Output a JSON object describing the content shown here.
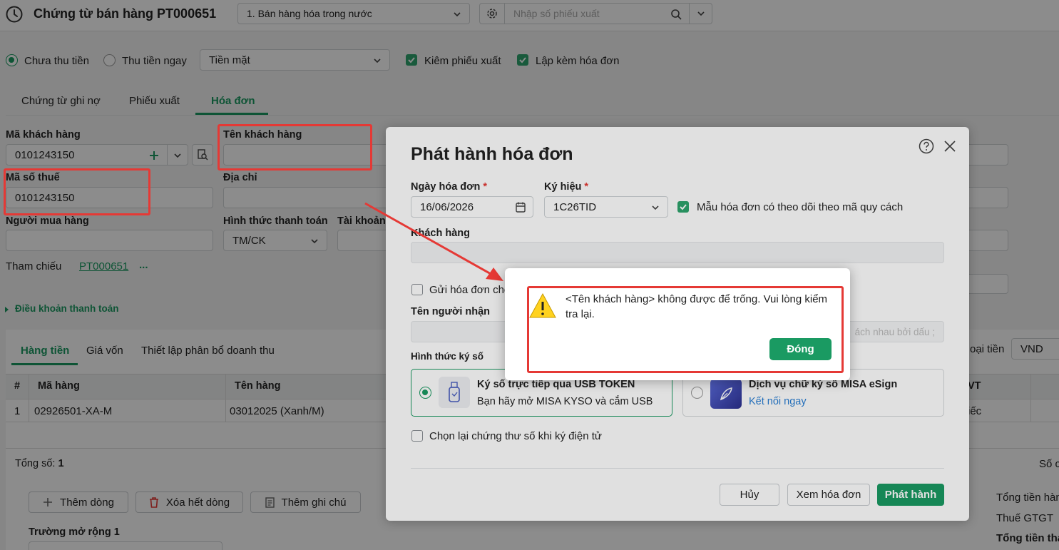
{
  "header": {
    "title": "Chứng từ bán hàng PT000651",
    "type_select": "1. Bán hàng hóa trong nước",
    "search_placeholder": "Nhập số phiếu xuất"
  },
  "payment": {
    "unpaid": "Chưa thu tiền",
    "paid_now": "Thu tiền ngay",
    "method": "Tiền mặt",
    "with_export": "Kiêm phiếu xuất",
    "with_invoice": "Lập kèm hóa đơn"
  },
  "tabs": [
    "Chứng từ ghi nợ",
    "Phiếu xuất",
    "Hóa đơn"
  ],
  "form": {
    "customer_code_label": "Mã khách hàng",
    "customer_code": "0101243150",
    "customer_name_label": "Tên khách hàng",
    "tax_code_label": "Mã số thuế",
    "tax_code": "0101243150",
    "address_label": "Địa chỉ",
    "buyer_label": "Người mua hàng",
    "payment_method_label": "Hình thức thanh toán",
    "payment_method": "TM/CK",
    "account_label": "Tài khoản",
    "reference_label": "Tham chiếu",
    "reference_value": "PT000651",
    "reference_more": "...",
    "terms_link": "Điều khoản thanh toán"
  },
  "detail_tabs": [
    "Hàng tiền",
    "Giá vốn",
    "Thiết lập phân bổ doanh thu"
  ],
  "currency_label": "oại tiền",
  "currency": "VND",
  "table": {
    "headers": [
      "#",
      "Mã hàng",
      "Tên hàng",
      "VT"
    ],
    "rows": [
      [
        "1",
        "02926501-XA-M",
        "03012025 (Xanh/M)",
        "iếc"
      ]
    ]
  },
  "footer": {
    "total_label": "Tổng số: ",
    "total_value": "1",
    "add_row": "Thêm dòng",
    "delete_rows": "Xóa hết dòng",
    "add_note": "Thêm ghi chú",
    "extend_field": "Trường mở rộng 1",
    "right_so": "Số c",
    "sum_goods": "Tổng tiền hàn",
    "vat": "Thuế GTGT",
    "sum_pay": "Tổng tiền tha"
  },
  "modal": {
    "title": "Phát hành hóa đơn",
    "date_label": "Ngày hóa đơn",
    "date_value": "16/06/2026",
    "symbol_label": "Ký hiệu",
    "symbol_value": "1C26TID",
    "template_check": "Mẫu hóa đơn có theo dõi theo mã quy cách",
    "customer_label": "Khách hàng",
    "send_invoice": "Gửi hóa đơn cho",
    "receiver_label": "Tên người nhận",
    "receiver_hint": "ách nhau bởi dấu ;",
    "sign_method_label": "Hình thức ký số",
    "usb_title": "Ký số trực tiếp qua USB TOKEN",
    "usb_desc": "Bạn hãy mở MISA KYSO và cắm USB",
    "esign_title": "Dịch vụ chữ ký số MISA eSign",
    "esign_link": "Kết nối ngay",
    "reselect_cert": "Chọn lại chứng thư số khi ký điện tử",
    "cancel": "Hủy",
    "preview": "Xem hóa đơn",
    "publish": "Phát hành"
  },
  "alert": {
    "message": "<Tên khách hàng> không được để trống. Vui lòng kiểm tra lại.",
    "close": "Đóng"
  }
}
